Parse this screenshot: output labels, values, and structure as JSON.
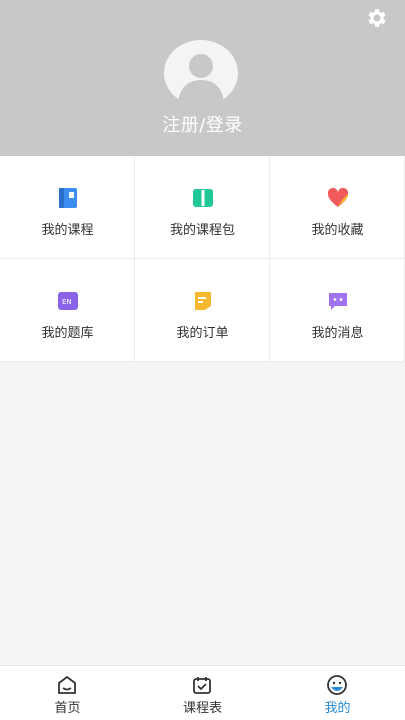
{
  "header": {
    "login_label": "注册/登录",
    "background_color": "#c8c8c8"
  },
  "grid": {
    "items": [
      {
        "label": "我的课程",
        "icon": "course-book-icon",
        "color": "#3b8df2"
      },
      {
        "label": "我的课程包",
        "icon": "course-package-icon",
        "color": "#20c997"
      },
      {
        "label": "我的收藏",
        "icon": "favorite-heart-icon",
        "color": "#f05a5a"
      },
      {
        "label": "我的题库",
        "icon": "question-bank-icon",
        "color": "#8a63e8"
      },
      {
        "label": "我的订单",
        "icon": "order-note-icon",
        "color": "#f5b82e"
      },
      {
        "label": "我的消息",
        "icon": "message-bubble-icon",
        "color": "#a273f0"
      }
    ]
  },
  "tabbar": {
    "tabs": [
      {
        "label": "首页",
        "icon": "home-icon",
        "active": false
      },
      {
        "label": "课程表",
        "icon": "calendar-icon",
        "active": false
      },
      {
        "label": "我的",
        "icon": "profile-icon",
        "active": true
      }
    ],
    "active_color": "#2a8bd6"
  }
}
